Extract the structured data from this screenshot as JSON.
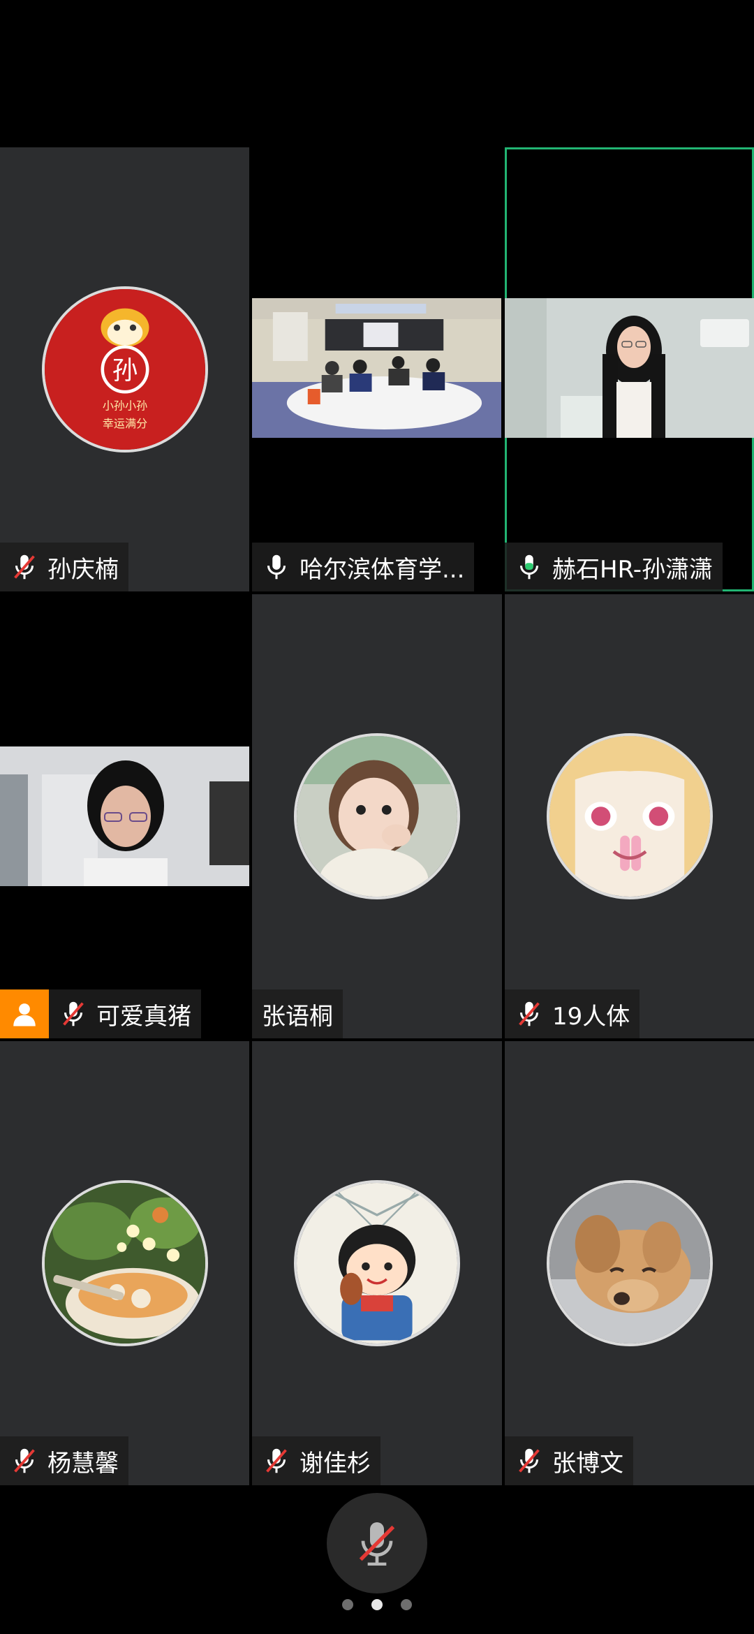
{
  "participants": [
    {
      "name": "孙庆楠",
      "mic": "muted",
      "type": "avatar",
      "avatar": "red-tiger-sun-logo",
      "avatar_text": [
        "孙",
        "小孙小孙",
        "幸运满分"
      ]
    },
    {
      "name": "哈尔滨体育学...",
      "mic": "on",
      "type": "video",
      "video": "classroom-meeting"
    },
    {
      "name": "赫石HR-孙潇潇",
      "mic": "speaking",
      "type": "video",
      "video": "woman-with-earphones",
      "active_speaker": true
    },
    {
      "name": "可爱真猪",
      "mic": "muted",
      "type": "video",
      "video": "woman-with-glasses",
      "host_badge": "person-icon"
    },
    {
      "name": "张语桐",
      "mic": "none",
      "type": "avatar",
      "avatar": "little-girl-photo"
    },
    {
      "name": "19人体",
      "mic": "muted",
      "type": "avatar",
      "avatar": "anime-girl"
    },
    {
      "name": "杨慧馨",
      "mic": "muted",
      "type": "avatar",
      "avatar": "dessert-with-flowers"
    },
    {
      "name": "谢佳杉",
      "mic": "muted",
      "type": "avatar",
      "avatar": "cartoon-girl"
    },
    {
      "name": "张博文",
      "mic": "muted",
      "type": "avatar",
      "avatar": "puppy-dog"
    }
  ],
  "colors": {
    "tile_bg": "#2c2d2f",
    "active_border": "#22b573",
    "host_badge": "#ff8a00",
    "mute_slash": "#e53935"
  },
  "controls": {
    "mic_button": "muted-microphone-icon",
    "pages": 3,
    "current_page": 2
  }
}
